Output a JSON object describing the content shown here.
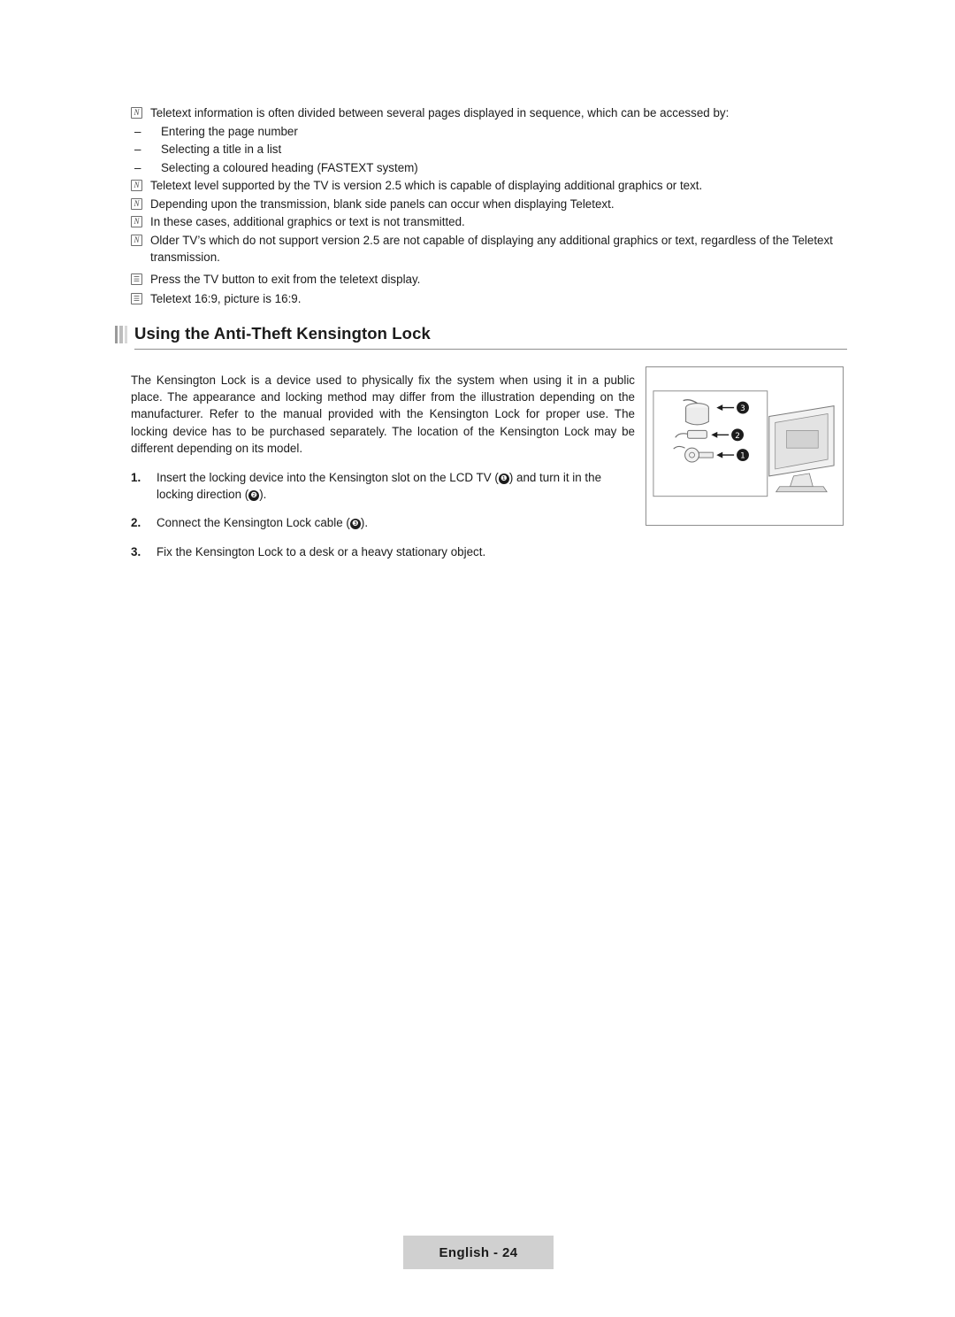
{
  "notes": [
    {
      "icon_glyph": "N",
      "icon_type": "note",
      "text": "Teletext information is often divided between several pages displayed in sequence, which can be accessed by:",
      "sub_items": [
        "Entering the page number",
        "Selecting a title in a list",
        "Selecting a coloured heading (FASTEXT system)"
      ]
    },
    {
      "icon_glyph": "N",
      "icon_type": "note",
      "text": "Teletext level supported by the TV is version 2.5 which is capable of displaying additional graphics or text.",
      "sub_items": []
    },
    {
      "icon_glyph": "N",
      "icon_type": "note",
      "text": "Depending upon the transmission, blank side panels can occur when displaying Teletext.",
      "sub_items": []
    },
    {
      "icon_glyph": "N",
      "icon_type": "note",
      "text": "In these cases, additional graphics or text is not transmitted.",
      "sub_items": []
    },
    {
      "icon_glyph": "N",
      "icon_type": "note",
      "text": "Older TV’s which do not support version 2.5 are not capable of displaying any additional graphics or text, regardless of the Teletext transmission.",
      "sub_items": []
    },
    {
      "icon_glyph": "☰",
      "icon_type": "press",
      "text": "Press the TV button to exit from the teletext display.",
      "sub_items": []
    },
    {
      "icon_glyph": "☰",
      "icon_type": "press",
      "text": "Teletext 16:9, picture is 16:9.",
      "sub_items": []
    }
  ],
  "section": {
    "title": "Using the Anti-Theft Kensington Lock"
  },
  "body": {
    "paragraph": "The Kensington Lock is a device used to physically fix the system when using it in a public place. The appearance and locking method may differ from the illustration depending on the manufacturer. Refer to the manual provided with the Kensington Lock for proper use. The locking device has to be purchased separately. The location of the Kensington Lock may be different depending on its model.",
    "steps": [
      {
        "number": "1.",
        "text_before": "Insert the locking device into the Kensington slot on the LCD TV (",
        "bullet_a": "❶",
        "text_middle": ") and turn it in the locking direction (",
        "bullet_b": "❷",
        "text_after": ")."
      },
      {
        "number": "2.",
        "text_before": "Connect the Kensington Lock cable (",
        "bullet_a": "❸",
        "text_middle": "",
        "bullet_b": "",
        "text_after": ")."
      },
      {
        "number": "3.",
        "text_before": "Fix the Kensington Lock to a desk or a heavy stationary object.",
        "bullet_a": "",
        "text_middle": "",
        "bullet_b": "",
        "text_after": ""
      }
    ]
  },
  "figure": {
    "callouts": [
      "3",
      "2",
      "1"
    ],
    "description": "Kensington lock inserted into the rear Kensington slot of an LCD TV"
  },
  "footer": {
    "page_label": "English - 24"
  }
}
